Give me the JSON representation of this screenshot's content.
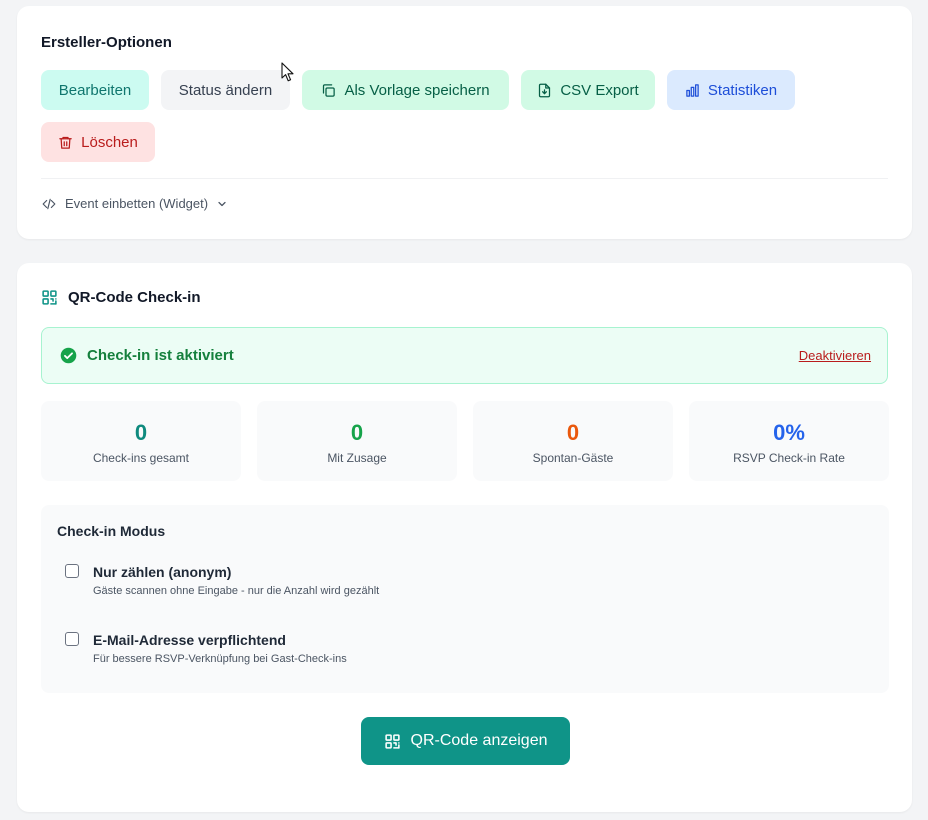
{
  "creator_options": {
    "title": "Ersteller-Optionen",
    "buttons": {
      "edit": "Bearbeiten",
      "change_status": "Status ändern",
      "save_template": "Als Vorlage speichern",
      "csv_export": "CSV Export",
      "statistics": "Statistiken",
      "delete": "Löschen"
    },
    "embed_label": "Event einbetten (Widget)"
  },
  "qr_checkin": {
    "title": "QR-Code Check-in",
    "alert_text": "Check-in ist aktiviert",
    "deactivate_label": "Deaktivieren",
    "stats": [
      {
        "value": "0",
        "label": "Check-ins gesamt",
        "color": "#0f8a7e"
      },
      {
        "value": "0",
        "label": "Mit Zusage",
        "color": "#16a34a"
      },
      {
        "value": "0",
        "label": "Spontan-Gäste",
        "color": "#ea580c"
      },
      {
        "value": "0%",
        "label": "RSVP Check-in Rate",
        "color": "#2563eb"
      }
    ],
    "mode": {
      "title": "Check-in Modus",
      "options": [
        {
          "label": "Nur zählen (anonym)",
          "description": "Gäste scannen ohne Eingabe - nur die Anzahl wird gezählt",
          "checked": false
        },
        {
          "label": "E-Mail-Adresse verpflichtend",
          "description": "Für bessere RSVP-Verknüpfung bei Gast-Check-ins",
          "checked": false
        }
      ]
    },
    "show_qr_label": "QR-Code anzeigen"
  },
  "icons": {
    "copy": "copy-icon",
    "file": "file-download-icon",
    "chart": "bar-chart-icon",
    "trash": "trash-icon",
    "code": "code-icon",
    "chevron": "chevron-down-icon",
    "qr": "qr-code-icon",
    "check": "check-circle-icon"
  },
  "colors": {
    "accent": "#0f9488",
    "success": "#15803d",
    "danger": "#b91c1c"
  }
}
